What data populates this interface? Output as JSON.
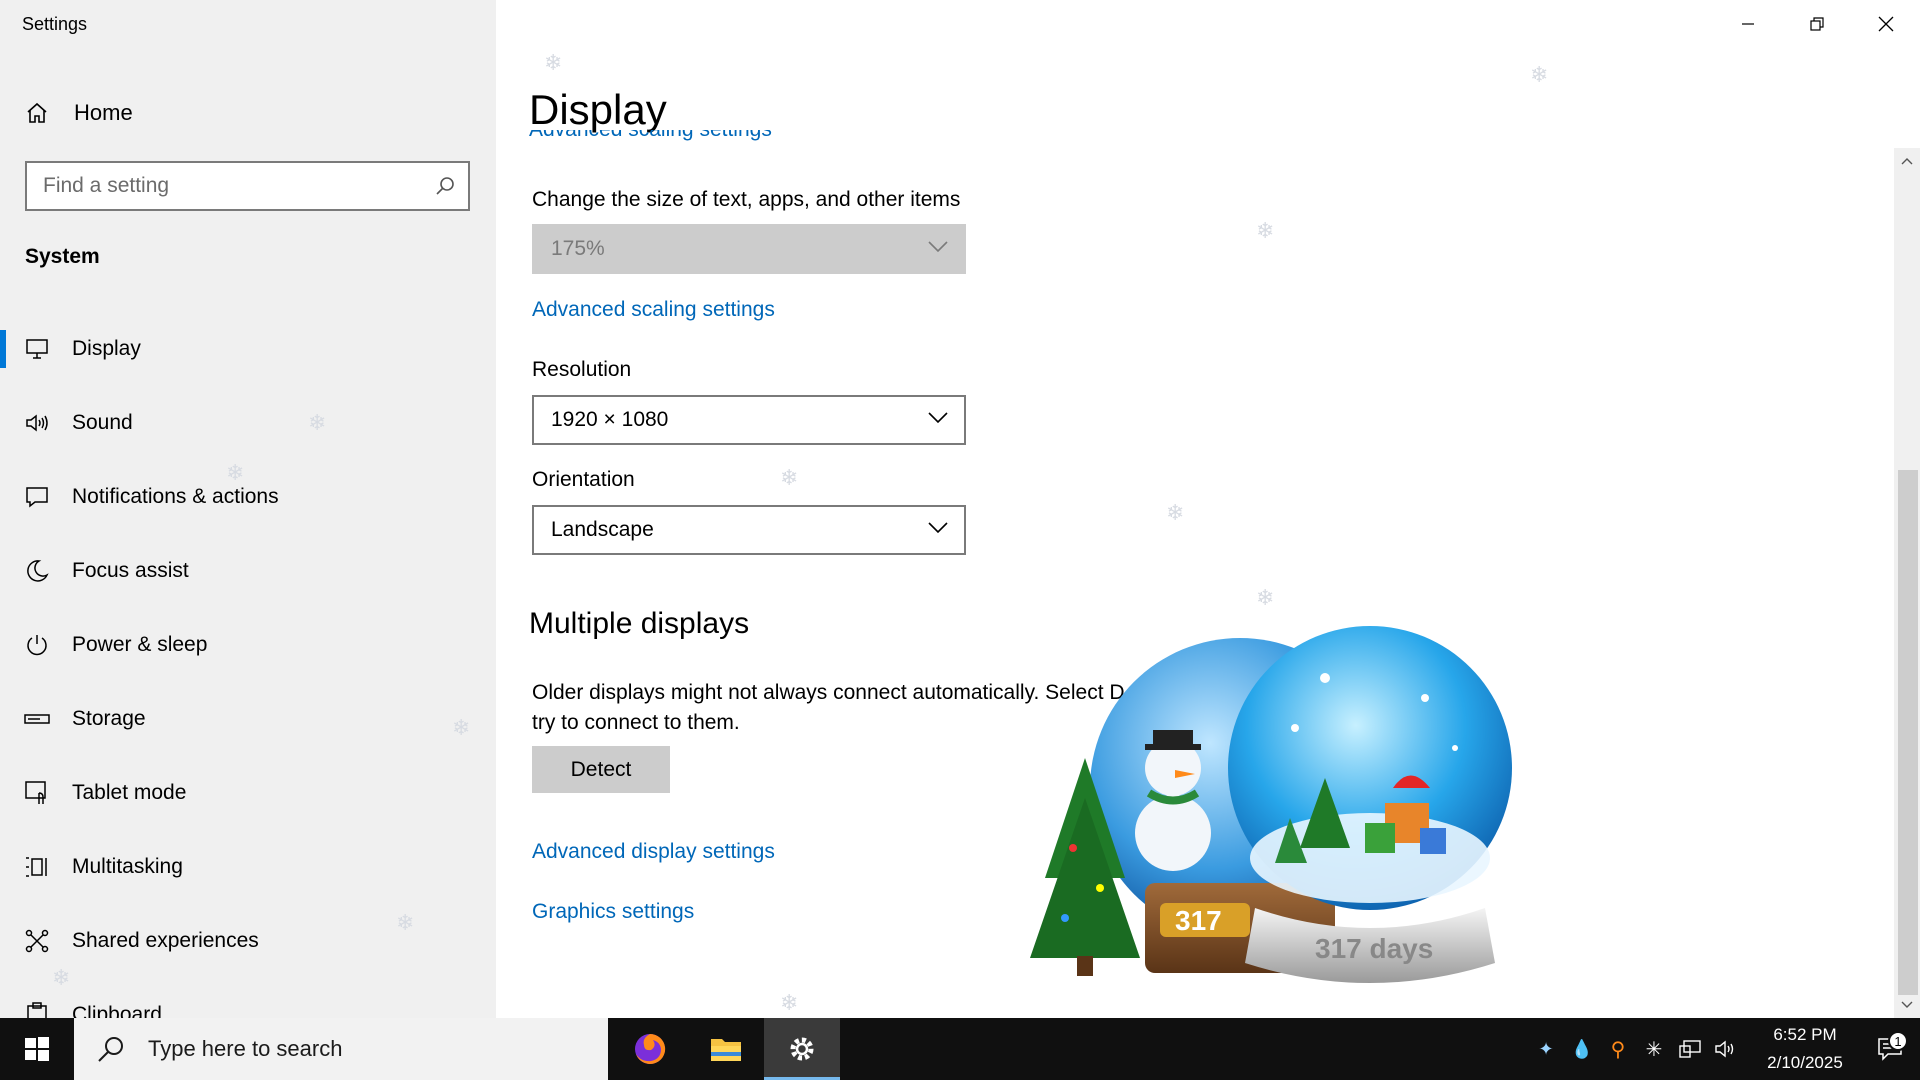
{
  "app": {
    "title": "Settings"
  },
  "sidebar": {
    "home_label": "Home",
    "search_placeholder": "Find a setting",
    "section_label": "System",
    "items": [
      {
        "label": "Display",
        "icon": "monitor-icon",
        "active": true
      },
      {
        "label": "Sound",
        "icon": "speaker-icon"
      },
      {
        "label": "Notifications & actions",
        "icon": "notification-icon"
      },
      {
        "label": "Focus assist",
        "icon": "moon-icon"
      },
      {
        "label": "Power & sleep",
        "icon": "power-icon"
      },
      {
        "label": "Storage",
        "icon": "storage-icon"
      },
      {
        "label": "Tablet mode",
        "icon": "tablet-mode-icon"
      },
      {
        "label": "Multitasking",
        "icon": "multitasking-icon"
      },
      {
        "label": "Shared experiences",
        "icon": "shared-experiences-icon"
      },
      {
        "label": "Clipboard",
        "icon": "clipboard-icon"
      }
    ]
  },
  "main": {
    "title": "Display",
    "scale_label": "Change the size of text, apps, and other items",
    "scale_value": "175%",
    "advanced_scaling_link": "Advanced scaling settings",
    "resolution_label": "Resolution",
    "resolution_value": "1920 × 1080",
    "orientation_label": "Orientation",
    "orientation_value": "Landscape",
    "multiple_displays_heading": "Multiple displays",
    "multiple_displays_desc_line1": "Older displays might not always connect automatically. Select D",
    "multiple_displays_desc_line2": "try to connect to them.",
    "detect_button": "Detect",
    "advanced_display_link": "Advanced display settings",
    "graphics_link": "Graphics settings"
  },
  "widget": {
    "days_label": "317 days",
    "days_back_label": "317"
  },
  "taskbar": {
    "search_placeholder": "Type here to search",
    "time": "6:52 PM",
    "date": "2/10/2025",
    "notification_count": "1"
  },
  "colors": {
    "accent": "#0078d7",
    "link": "#0067b8",
    "sidebar_bg": "#f0f0f0",
    "taskbar_bg": "#101010"
  }
}
